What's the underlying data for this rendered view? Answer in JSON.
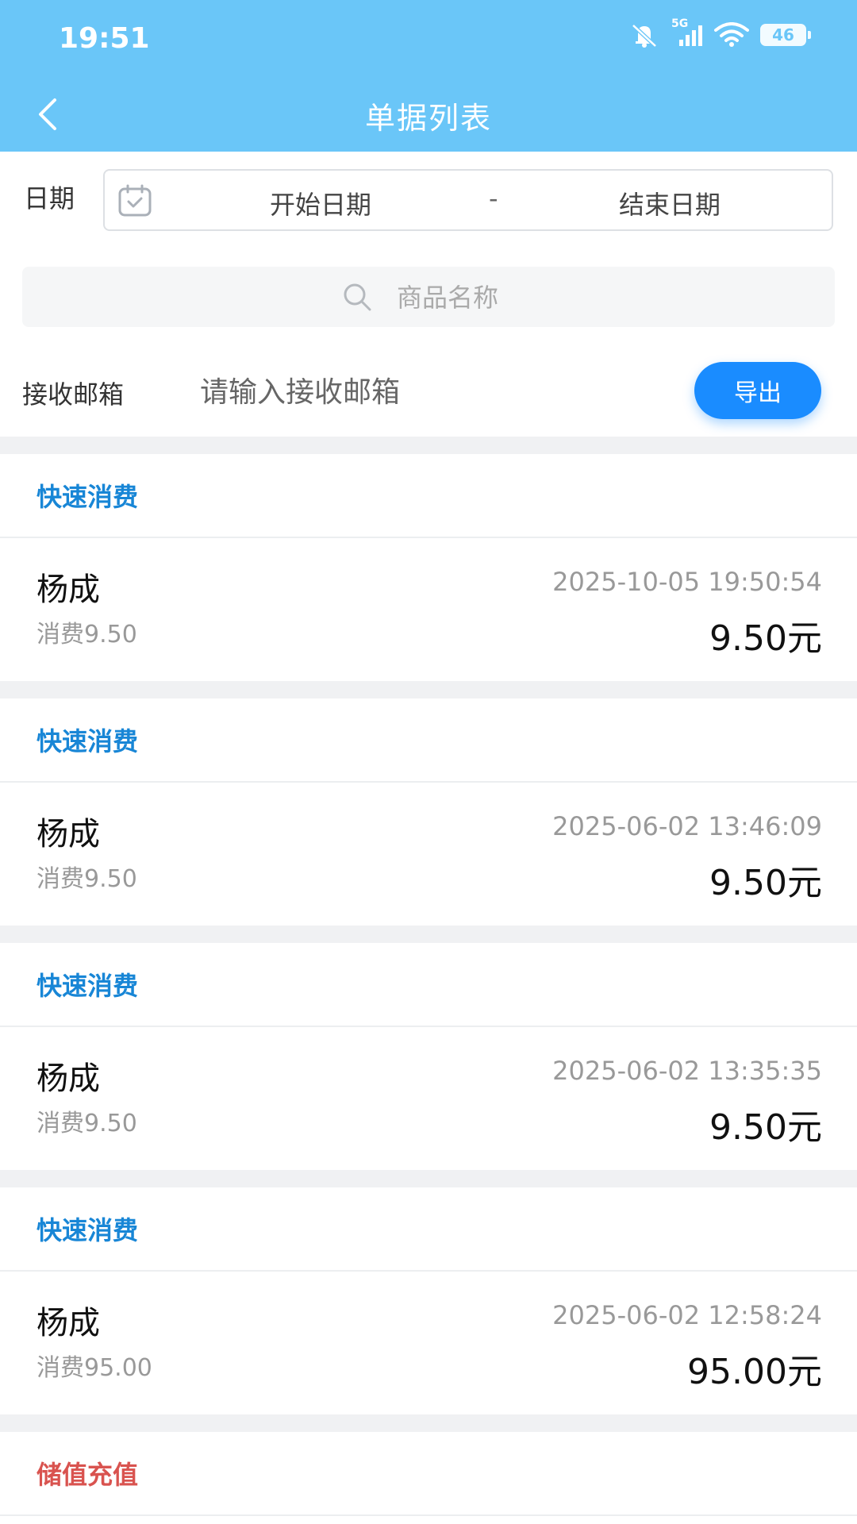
{
  "status_bar": {
    "time": "19:51",
    "network": "5G",
    "battery": "46"
  },
  "header": {
    "title": "单据列表"
  },
  "date_filter": {
    "label": "日期",
    "start": "开始日期",
    "separator": "-",
    "end": "结束日期"
  },
  "search": {
    "placeholder": "商品名称"
  },
  "email": {
    "label": "接收邮箱",
    "placeholder": "请输入接收邮箱",
    "export_label": "导出"
  },
  "colors": {
    "header_bg": "#6ac6f8",
    "accent": "#1a8cff",
    "type_blue": "#1886d6",
    "type_red": "#d9534f"
  },
  "records": [
    {
      "type": "快速消费",
      "name": "杨成",
      "desc": "消费9.50",
      "time": "2025-10-05 19:50:54",
      "amount": "9.50元"
    },
    {
      "type": "快速消费",
      "name": "杨成",
      "desc": "消费9.50",
      "time": "2025-06-02 13:46:09",
      "amount": "9.50元"
    },
    {
      "type": "快速消费",
      "name": "杨成",
      "desc": "消费9.50",
      "time": "2025-06-02 13:35:35",
      "amount": "9.50元"
    },
    {
      "type": "快速消费",
      "name": "杨成",
      "desc": "消费95.00",
      "time": "2025-06-02 12:58:24",
      "amount": "95.00元"
    },
    {
      "type": "储值充值"
    }
  ]
}
